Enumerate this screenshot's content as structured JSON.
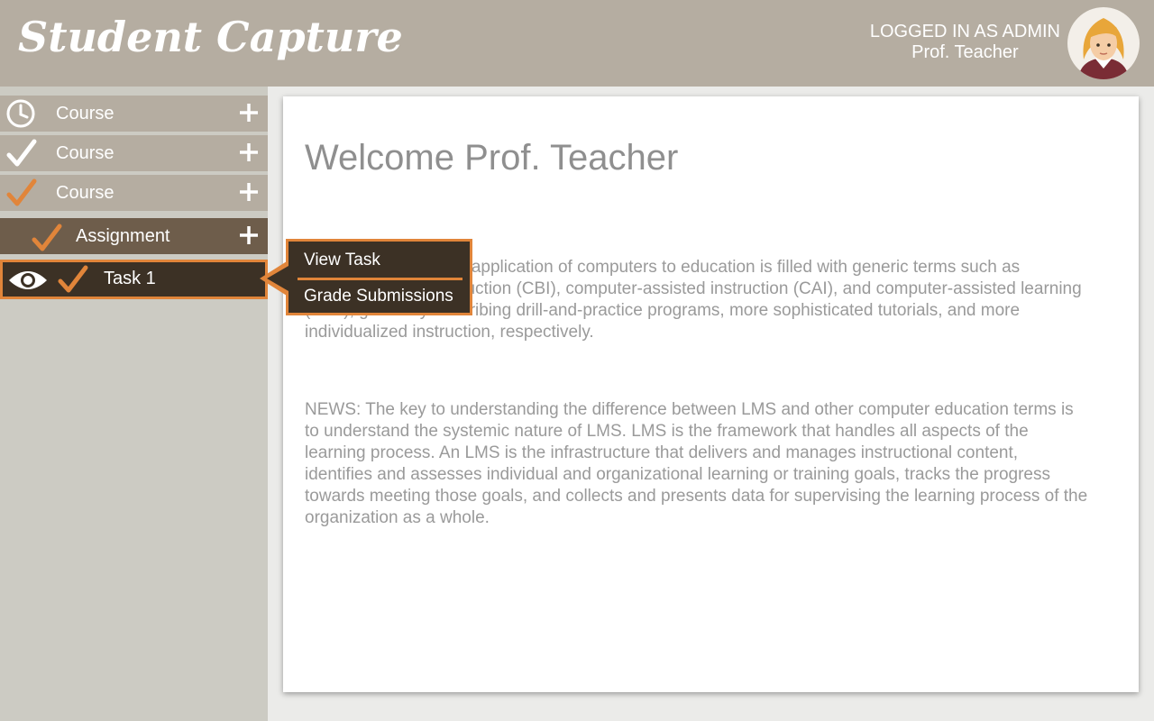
{
  "header": {
    "logo": "Student Capture",
    "login_status": "LOGGED IN AS ADMIN",
    "user_name": "Prof. Teacher",
    "avatar_icon": "teacher-avatar"
  },
  "sidebar": {
    "items": [
      {
        "label": "Course",
        "status_icon": "clock-icon",
        "action_icon": "plus-icon"
      },
      {
        "label": "Course",
        "status_icon": "check-icon-white",
        "action_icon": "plus-icon"
      },
      {
        "label": "Course",
        "status_icon": "check-icon-orange",
        "action_icon": "plus-icon"
      },
      {
        "label": "Assignment",
        "status_icon": "check-icon-orange",
        "action_icon": "plus-icon"
      },
      {
        "label": "Task 1",
        "status_icon": "check-icon-orange",
        "view_icon": "eye-icon"
      }
    ]
  },
  "popup_menu": {
    "items": [
      "View Task",
      "Grade Submissions"
    ]
  },
  "main": {
    "welcome": "Welcome Prof. Teacher",
    "paragraph1": "The discussion of the application of computers to education is filled with generic terms such as computer-based instruction (CBI), computer-assisted instruction (CAI), and computer-assisted learning (CAL), generally describing drill-and-practice programs, more sophisticated tutorials, and more individualized instruction, respectively.",
    "paragraph2": "NEWS: The key to understanding the difference between LMS and other computer education terms is to understand the systemic nature of LMS. LMS is the framework that handles all aspects of the learning process. An LMS is the infrastructure that delivers and manages instructional content, identifies and assesses individual and organizational learning or training goals, tracks the progress towards meeting those goals, and collects and presents data for supervising the learning process of the organization as a whole."
  },
  "colors": {
    "header_bg": "#b5ada1",
    "accent_orange": "#e1853a",
    "dark_brown": "#3c3125",
    "assignment_brown": "#6e5d4b",
    "sidebar_bg": "#cccbc3"
  }
}
